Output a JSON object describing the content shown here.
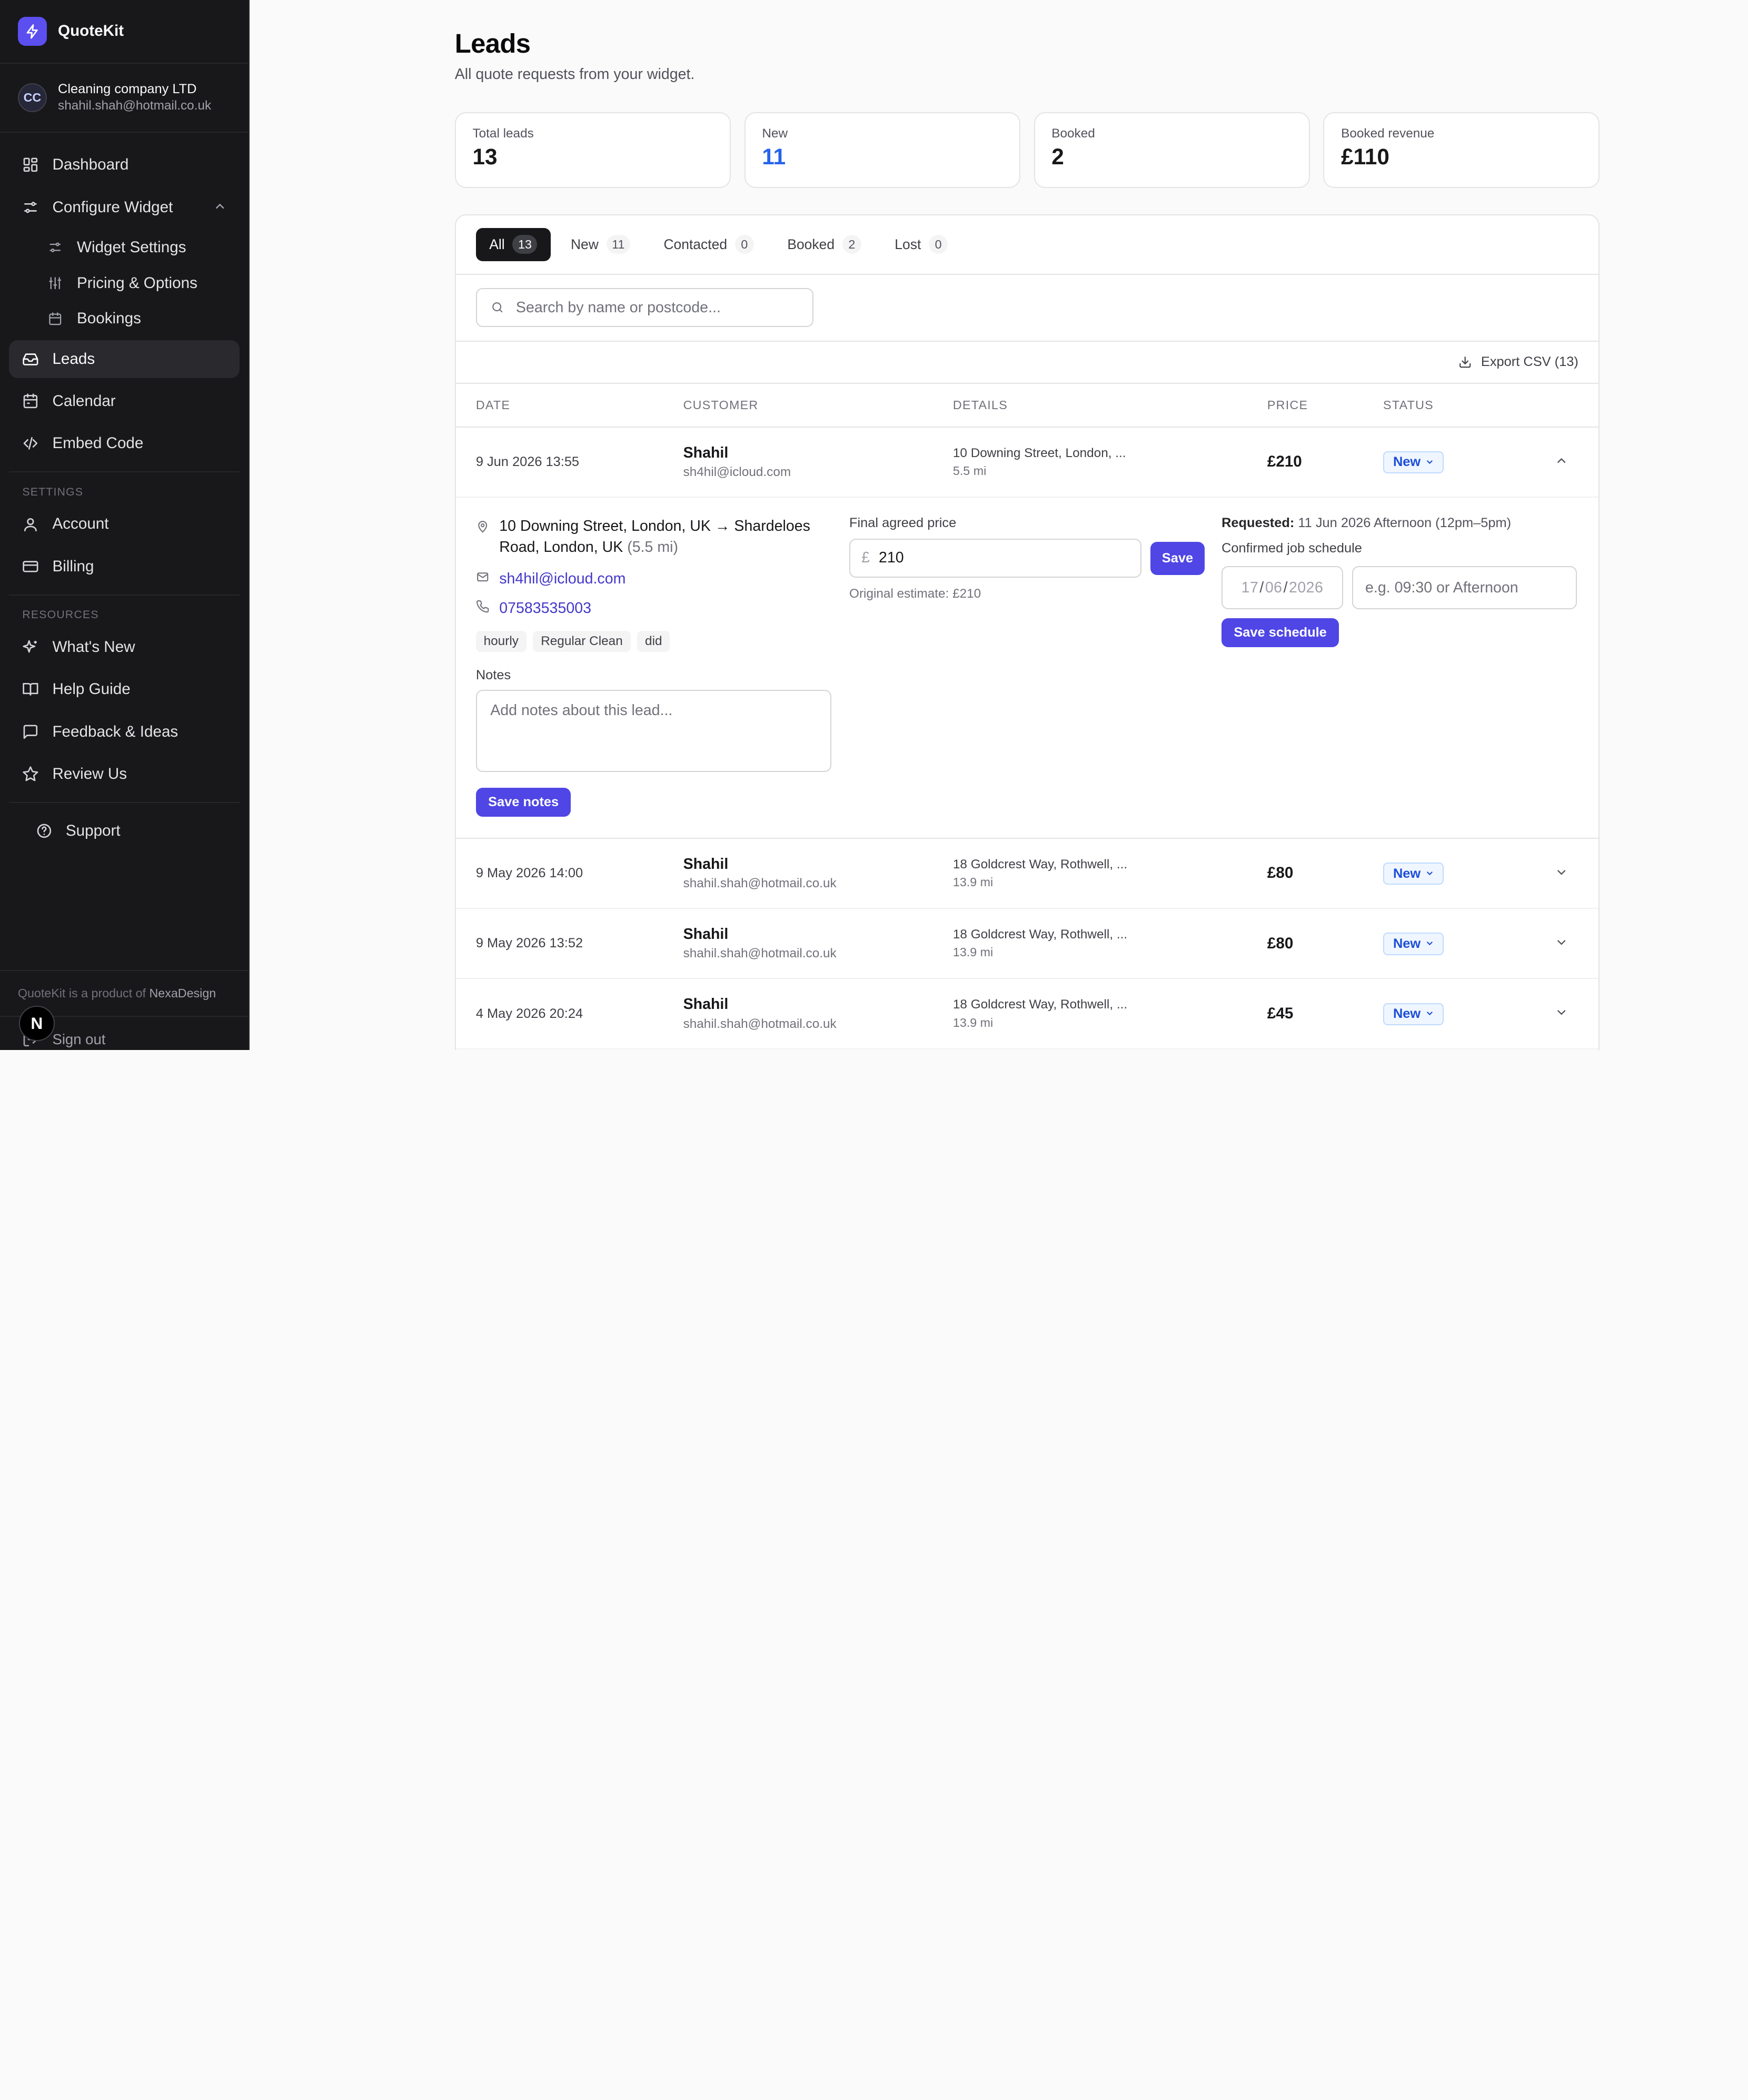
{
  "brand": {
    "name": "QuoteKit",
    "accent": "#5b4ff0"
  },
  "account": {
    "initials": "CC",
    "company": "Cleaning company LTD",
    "email": "shahil.shah@hotmail.co.uk"
  },
  "nav": {
    "dashboard": "Dashboard",
    "configure_widget": "Configure Widget",
    "widget_settings": "Widget Settings",
    "pricing_options": "Pricing & Options",
    "bookings": "Bookings",
    "leads": "Leads",
    "calendar": "Calendar",
    "embed_code": "Embed Code",
    "settings_label": "Settings",
    "account": "Account",
    "billing": "Billing",
    "resources_label": "Resources",
    "whats_new": "What's New",
    "help_guide": "Help Guide",
    "feedback": "Feedback & Ideas",
    "review_us": "Review Us",
    "support": "Support"
  },
  "footer": {
    "product_of": "QuoteKit is a product of",
    "company": "NexaDesign",
    "sign_out": "Sign out",
    "badge": "N"
  },
  "page": {
    "title": "Leads",
    "subtitle": "All quote requests from your widget."
  },
  "stats": [
    {
      "label": "Total leads",
      "value": "13"
    },
    {
      "label": "New",
      "value": "11"
    },
    {
      "label": "Booked",
      "value": "2"
    },
    {
      "label": "Booked revenue",
      "value": "£110"
    }
  ],
  "tabs": [
    {
      "label": "All",
      "count": "13"
    },
    {
      "label": "New",
      "count": "11"
    },
    {
      "label": "Contacted",
      "count": "0"
    },
    {
      "label": "Booked",
      "count": "2"
    },
    {
      "label": "Lost",
      "count": "0"
    }
  ],
  "search": {
    "placeholder": "Search by name or postcode..."
  },
  "export_label": "Export CSV (13)",
  "columns": {
    "date": "Date",
    "customer": "Customer",
    "details": "Details",
    "price": "Price",
    "status": "Status"
  },
  "rows": [
    {
      "date": "9 Jun 2026 13:55",
      "name": "Shahil",
      "email": "sh4hil@icloud.com",
      "address": "10 Downing Street, London, ...",
      "distance": "5.5 mi",
      "price": "£210",
      "status": "New"
    },
    {
      "date": "9 May 2026 14:00",
      "name": "Shahil",
      "email": "shahil.shah@hotmail.co.uk",
      "address": "18 Goldcrest Way, Rothwell, ...",
      "distance": "13.9 mi",
      "price": "£80",
      "status": "New"
    },
    {
      "date": "9 May 2026 13:52",
      "name": "Shahil",
      "email": "shahil.shah@hotmail.co.uk",
      "address": "18 Goldcrest Way, Rothwell, ...",
      "distance": "13.9 mi",
      "price": "£80",
      "status": "New"
    },
    {
      "date": "4 May 2026 20:24",
      "name": "Shahil",
      "email": "shahil.shah@hotmail.co.uk",
      "address": "18 Goldcrest Way, Rothwell, ...",
      "distance": "13.9 mi",
      "price": "£45",
      "status": "New"
    }
  ],
  "expanded": {
    "route": "10 Downing Street, London, UK → Shardeloes Road, London, UK",
    "route_distance": "(5.5 mi)",
    "email": "sh4hil@icloud.com",
    "phone": "07583535003",
    "tags": [
      "hourly",
      "Regular Clean",
      "did"
    ],
    "notes_label": "Notes",
    "notes_placeholder": "Add notes about this lead...",
    "save_notes": "Save notes",
    "final_price_label": "Final agreed price",
    "currency": "£",
    "final_price_value": "210",
    "save_price": "Save",
    "original_estimate": "Original estimate: £210",
    "requested_label": "Requested:",
    "requested_value": "11 Jun 2026 Afternoon (12pm–5pm)",
    "confirmed_label": "Confirmed job schedule",
    "date_day": "17",
    "date_month": "06",
    "date_year": "2026",
    "time_placeholder": "e.g. 09:30 or Afternoon",
    "save_schedule": "Save schedule"
  }
}
